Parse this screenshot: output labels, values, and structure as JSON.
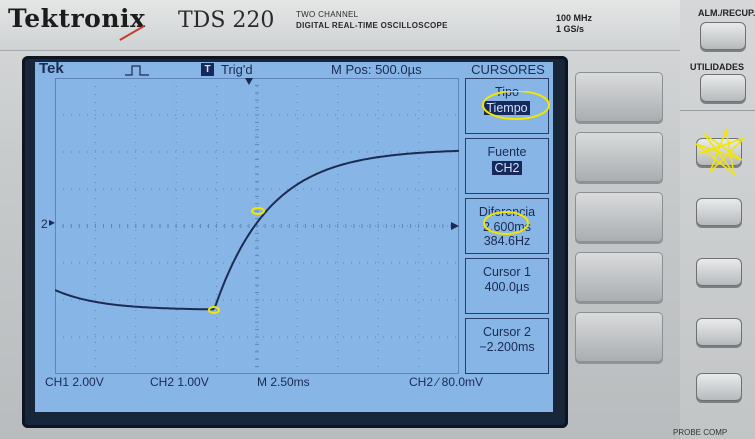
{
  "header": {
    "brand": "Tektronix",
    "model": "TDS 220",
    "subtitle_line1": "TWO CHANNEL",
    "subtitle_line2": "DIGITAL REAL-TIME OSCILLOSCOPE",
    "spec_bandwidth": "100 MHz",
    "spec_sample_rate": "1 GS/s"
  },
  "screen": {
    "status": {
      "logo": "Tek",
      "trigger_icon": "T",
      "trigger_state": "Trig'd",
      "position": "M Pos: 500.0µs"
    },
    "menu": {
      "title": "CURSORES",
      "items": [
        {
          "label": "Tipo",
          "value": "Tiempo"
        },
        {
          "label": "Fuente",
          "value": "CH2"
        },
        {
          "label": "Diferencia",
          "value": "2.600ms",
          "value2": "384.6Hz"
        },
        {
          "label": "Cursor 1",
          "value": "400.0µs"
        },
        {
          "label": "Cursor 2",
          "value": "−2.200ms"
        }
      ]
    },
    "channel_marker": "2",
    "bottom": {
      "ch1": "CH1   2.00V",
      "ch2": "CH2   1.00V",
      "timebase": "M  2.50ms",
      "trigger": "CH2  ∕  80.0mV"
    },
    "colors": {
      "screen_bg": "#86b5e6",
      "trace": "#1c2b52",
      "annotation": "#f2e600"
    }
  },
  "buttons": {
    "top_label": "ALM./RECUP.",
    "second_label": "UTILIDADES",
    "bottom_label": "PROBE COMP"
  }
}
